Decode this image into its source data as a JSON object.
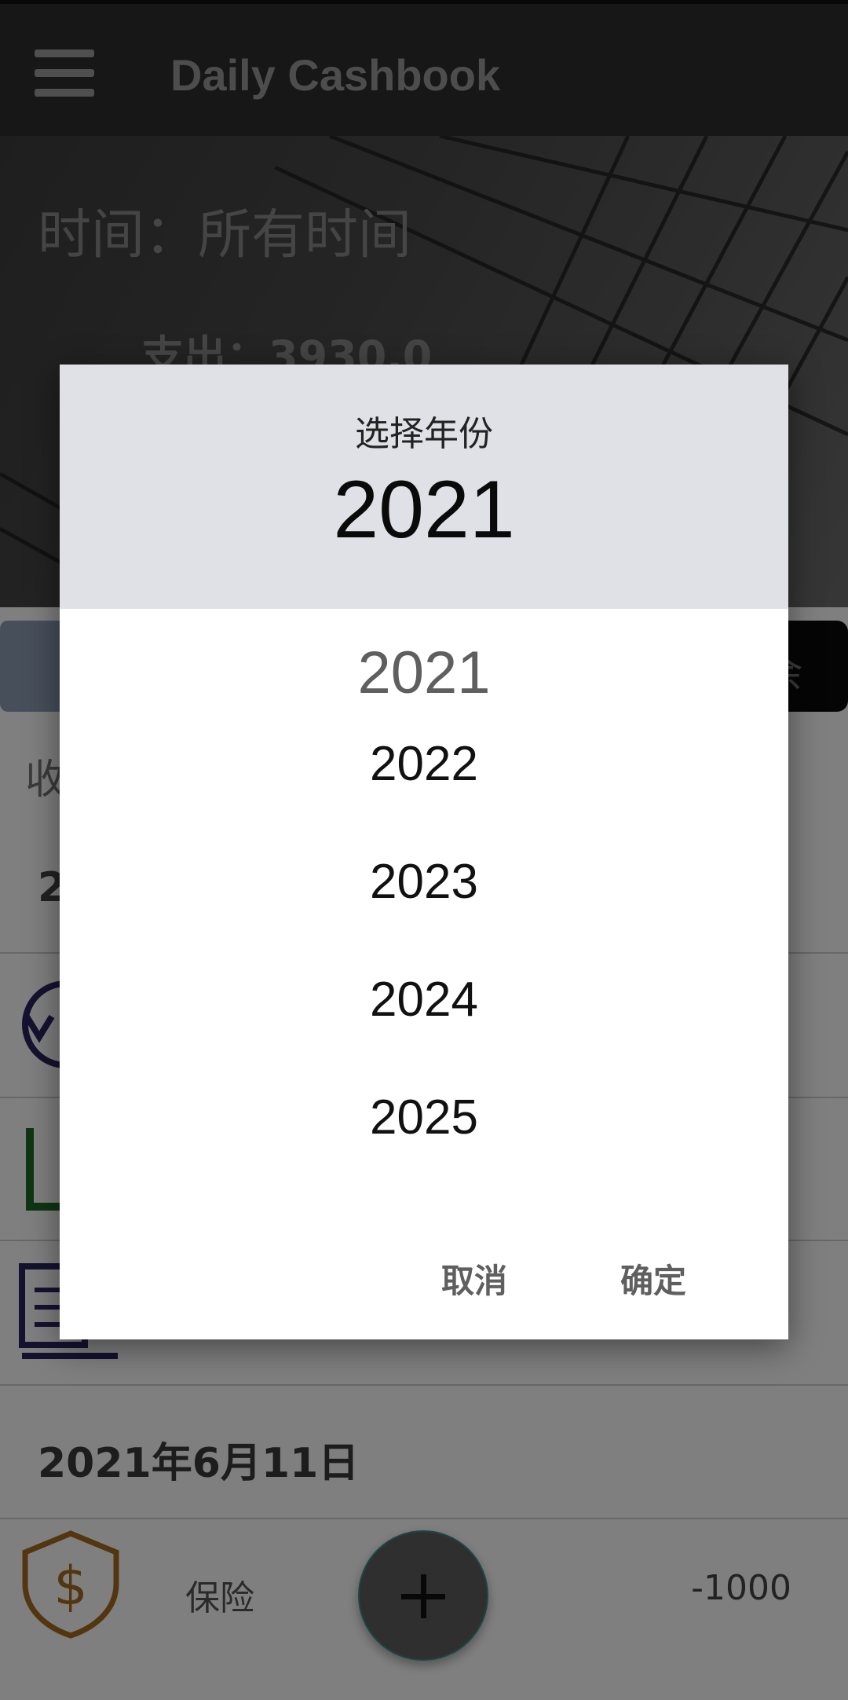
{
  "app": {
    "title": "Daily Cashbook"
  },
  "summary": {
    "time_label": "时间：所有时间",
    "expense_label": "支出：3930.0"
  },
  "tabs": {
    "right_label": "余"
  },
  "list": {
    "income_label": "收",
    "partial_row": "2",
    "date_header": "2021年6月11日",
    "item": {
      "label": "保险",
      "amount": "-1000"
    }
  },
  "dialog": {
    "title": "选择年份",
    "selected_year": "2021",
    "years": [
      "2021",
      "2022",
      "2023",
      "2024",
      "2025"
    ],
    "cancel_label": "取消",
    "confirm_label": "确定"
  },
  "colors": {
    "appbar": "#2f2f2f",
    "dialog_header": "#e0e1e6",
    "fab": "#5e5e5e",
    "icon_orange": "#a66a1f",
    "icon_purple": "#2b2560",
    "icon_green": "#1f6b2a"
  }
}
